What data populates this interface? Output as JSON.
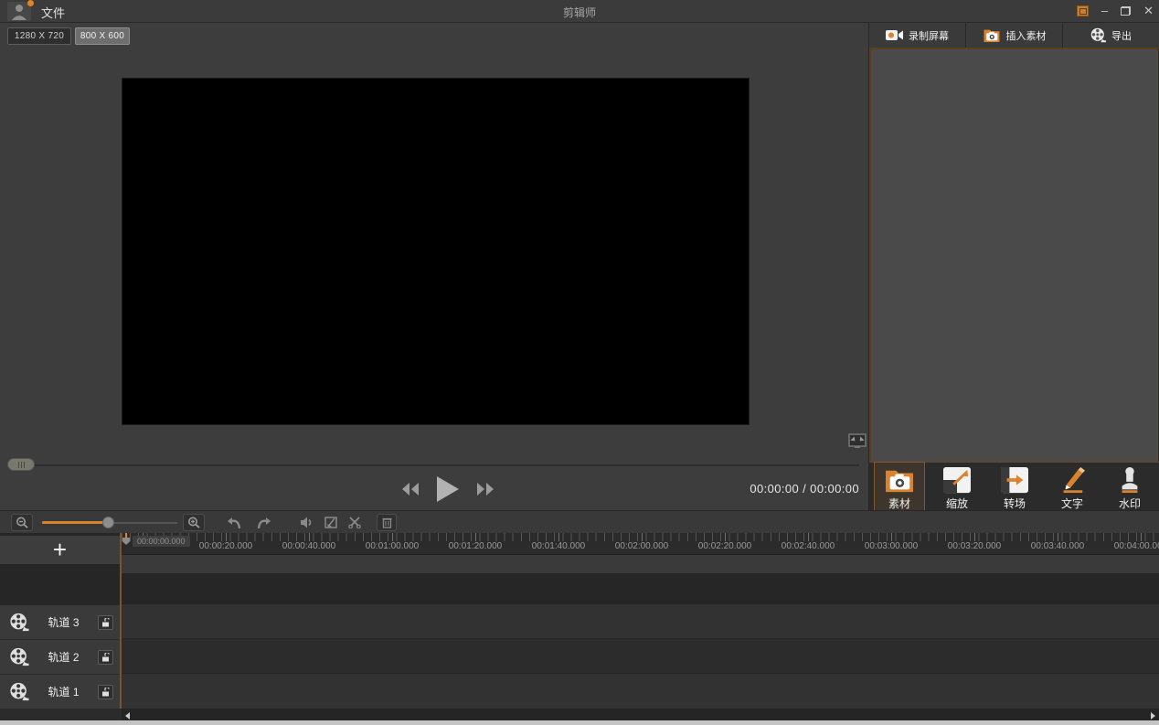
{
  "titlebar": {
    "file_menu": "文件",
    "app_title": "剪辑师",
    "minimize": "–",
    "close": "✕"
  },
  "resolution_buttons": {
    "hd": "1280 X 720",
    "svga": "800 X 600"
  },
  "top_actions": {
    "record_screen": "录制屏幕",
    "insert_material": "插入素材",
    "export": "导出"
  },
  "player": {
    "time_display": "00:00:00 / 00:00:00"
  },
  "panel_tabs": {
    "material": "素材",
    "scale": "缩放",
    "transition": "转场",
    "text": "文字",
    "watermark": "水印"
  },
  "timeline": {
    "playhead_time": "00:00:00.000",
    "ruler_labels": [
      "00:00:20.000",
      "00:00:40.000",
      "00:01:00.000",
      "00:01:20.000",
      "00:01:40.000",
      "00:02:00.000",
      "00:02:20.000",
      "00:02:40.000",
      "00:03:00.000",
      "00:03:20.000",
      "00:03:40.000",
      "00:04:00.000"
    ],
    "add_track_label": "+",
    "tracks": [
      {
        "label": "轨道 3"
      },
      {
        "label": "轨道 2"
      },
      {
        "label": "轨道 1"
      }
    ]
  },
  "colors": {
    "accent": "#d9832e",
    "panel_border": "#6b4423"
  }
}
